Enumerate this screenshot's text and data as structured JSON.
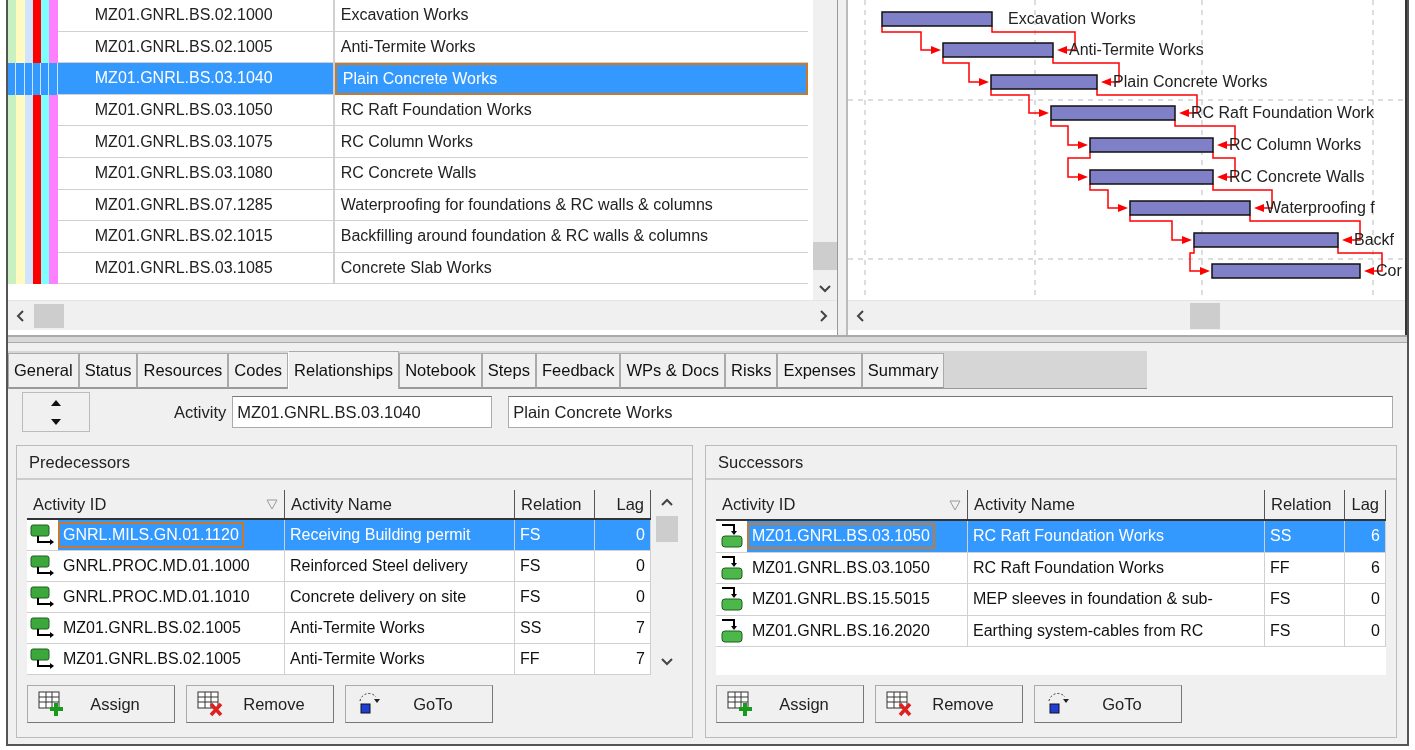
{
  "code_strips": [
    {
      "color": "#c8f0c0"
    },
    {
      "color": "#fffbc0"
    },
    {
      "color": "#d0e4ff"
    },
    {
      "color": "#ff0000"
    },
    {
      "color": "#80ffff"
    },
    {
      "color": "#ff80ff"
    }
  ],
  "activities_table": {
    "rows": [
      {
        "id": "MZ01.GNRL.BS.02.1000",
        "name": "Excavation Works",
        "selected": false
      },
      {
        "id": "MZ01.GNRL.BS.02.1005",
        "name": "Anti-Termite Works",
        "selected": false
      },
      {
        "id": "MZ01.GNRL.BS.03.1040",
        "name": "Plain Concrete Works",
        "selected": true
      },
      {
        "id": "MZ01.GNRL.BS.03.1050",
        "name": "RC Raft Foundation Works",
        "selected": false
      },
      {
        "id": "MZ01.GNRL.BS.03.1075",
        "name": "RC Column Works",
        "selected": false
      },
      {
        "id": "MZ01.GNRL.BS.03.1080",
        "name": "RC Concrete Walls",
        "selected": false
      },
      {
        "id": "MZ01.GNRL.BS.07.1285",
        "name": "Waterproofing for foundations & RC walls & columns",
        "selected": false
      },
      {
        "id": "MZ01.GNRL.BS.02.1015",
        "name": "Backfilling around foundation & RC walls & columns",
        "selected": false
      },
      {
        "id": "MZ01.GNRL.BS.03.1085",
        "name": "Concrete Slab Works",
        "selected": false
      }
    ]
  },
  "gantt": {
    "bars": [
      {
        "label": "Excavation Works"
      },
      {
        "label": "Anti-Termite Works"
      },
      {
        "label": "Plain Concrete Works"
      },
      {
        "label": "RC Raft Foundation Work"
      },
      {
        "label": "RC Column Works"
      },
      {
        "label": "RC Concrete Walls"
      },
      {
        "label": "Waterproofing f"
      },
      {
        "label": "Backf"
      },
      {
        "label": "Cor"
      }
    ]
  },
  "tabs": [
    {
      "label": "General",
      "selected": false
    },
    {
      "label": "Status",
      "selected": false
    },
    {
      "label": "Resources",
      "selected": false
    },
    {
      "label": "Codes",
      "selected": false
    },
    {
      "label": "Relationships",
      "selected": true
    },
    {
      "label": "Notebook",
      "selected": false
    },
    {
      "label": "Steps",
      "selected": false
    },
    {
      "label": "Feedback",
      "selected": false
    },
    {
      "label": "WPs & Docs",
      "selected": false
    },
    {
      "label": "Risks",
      "selected": false
    },
    {
      "label": "Expenses",
      "selected": false
    },
    {
      "label": "Summary",
      "selected": false
    }
  ],
  "activity": {
    "label": "Activity",
    "id": "MZ01.GNRL.BS.03.1040",
    "name": "Plain Concrete Works"
  },
  "predecessors": {
    "title": "Predecessors",
    "columns": [
      "Activity ID",
      "Activity Name",
      "Relation",
      "Lag"
    ],
    "rows": [
      {
        "id": "GNRL.MILS.GN.01.1120",
        "name": "Receiving Building permit",
        "relation": "FS",
        "lag": "0",
        "selected": true
      },
      {
        "id": "GNRL.PROC.MD.01.1000",
        "name": "Reinforced Steel delivery",
        "relation": "FS",
        "lag": "0",
        "selected": false
      },
      {
        "id": "GNRL.PROC.MD.01.1010",
        "name": "Concrete delivery on site",
        "relation": "FS",
        "lag": "0",
        "selected": false
      },
      {
        "id": "MZ01.GNRL.BS.02.1005",
        "name": "Anti-Termite Works",
        "relation": "SS",
        "lag": "7",
        "selected": false
      },
      {
        "id": "MZ01.GNRL.BS.02.1005",
        "name": "Anti-Termite Works",
        "relation": "FF",
        "lag": "7",
        "selected": false
      }
    ],
    "buttons": [
      {
        "kind": "assign",
        "label": "Assign"
      },
      {
        "kind": "remove",
        "label": "Remove"
      },
      {
        "kind": "goto",
        "label": "GoTo"
      }
    ]
  },
  "successors": {
    "title": "Successors",
    "columns": [
      "Activity ID",
      "Activity Name",
      "Relation",
      "Lag"
    ],
    "rows": [
      {
        "id": "MZ01.GNRL.BS.03.1050",
        "name": "RC Raft Foundation Works",
        "relation": "SS",
        "lag": "6",
        "selected": true
      },
      {
        "id": "MZ01.GNRL.BS.03.1050",
        "name": "RC Raft Foundation Works",
        "relation": "FF",
        "lag": "6",
        "selected": false
      },
      {
        "id": "MZ01.GNRL.BS.15.5015",
        "name": "MEP sleeves in foundation & sub-",
        "relation": "FS",
        "lag": "0",
        "selected": false
      },
      {
        "id": "MZ01.GNRL.BS.16.2020",
        "name": "Earthing system-cables from RC",
        "relation": "FS",
        "lag": "0",
        "selected": false
      }
    ],
    "buttons": [
      {
        "kind": "assign",
        "label": "Assign"
      },
      {
        "kind": "remove",
        "label": "Remove"
      },
      {
        "kind": "goto",
        "label": "GoTo"
      }
    ]
  }
}
